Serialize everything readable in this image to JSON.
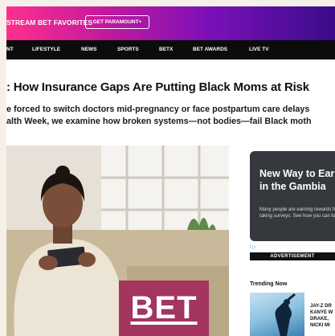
{
  "promo": {
    "text": "STREAM BET FAVORITES",
    "button_label": "GET PARAMOUNT+"
  },
  "nav": {
    "items": [
      "NT",
      "LIFESTYLE",
      "NEWS",
      "SPORTS",
      "BETX",
      "BET AWARDS",
      "LIVE TV"
    ]
  },
  "article": {
    "headline": ": How Insurance Gaps Are Putting Black Moms at Risk",
    "dek_line_1": "e forced to switch doctors mid-pregnancy or face postpartum care delays",
    "dek_line_2": "alth Week, we examine how broken systems—not bodies—fail Black moth"
  },
  "watermark": {
    "text": "BET"
  },
  "ad": {
    "title": "New Way to Earn in the Gambia",
    "body": "Many people are earning rewards for taking surveys. See how you can too.",
    "choice_label": "I ▷",
    "bar_label": "ADVERTISEMENT"
  },
  "trending": {
    "title": "Trending Now",
    "item_lines": [
      "JAY-Z DR",
      "KANYE W",
      "DRAKE,",
      "NICKI MI"
    ]
  },
  "colors": {
    "promo_gradient_start": "#ff2f8f",
    "promo_gradient_end": "#3a0c8a",
    "nav_background": "#0c0c0c",
    "logo_background": "#a3355f",
    "ad_background": "#35383d"
  },
  "icons": {
    "ad_choice": "ad-choices-icon"
  }
}
